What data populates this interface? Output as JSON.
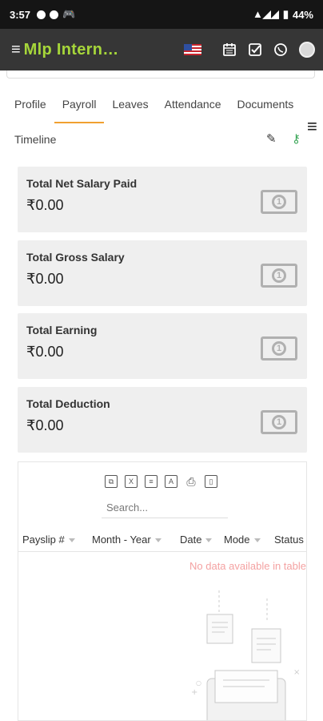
{
  "status_bar": {
    "time": "3:57",
    "battery": "44%"
  },
  "app_bar": {
    "title": "Mlp Intern…"
  },
  "tabs": [
    "Profile",
    "Payroll",
    "Leaves",
    "Attendance",
    "Documents"
  ],
  "active_tab": "Payroll",
  "timeline_label": "Timeline",
  "summary_cards": [
    {
      "label": "Total Net Salary Paid",
      "value": "₹0.00"
    },
    {
      "label": "Total Gross Salary",
      "value": "₹0.00"
    },
    {
      "label": "Total Earning",
      "value": "₹0.00"
    },
    {
      "label": "Total Deduction",
      "value": "₹0.00"
    }
  ],
  "table": {
    "search_placeholder": "Search...",
    "columns": [
      "Payslip #",
      "Month - Year",
      "Date",
      "Mode",
      "Status"
    ],
    "empty_message": "No data available in table"
  },
  "colors": {
    "accent": "#a6d63a",
    "tab_underline": "#f0a030",
    "empty_text": "#f4a2a2"
  },
  "icons": [
    "menu-icon",
    "us-flag-icon",
    "calendar-icon",
    "checkbox-icon",
    "whatsapp-icon",
    "avatar",
    "pencil-icon",
    "key-icon",
    "copy-icon",
    "excel-icon",
    "csv-icon",
    "pdf-icon",
    "print-icon",
    "columns-icon"
  ]
}
